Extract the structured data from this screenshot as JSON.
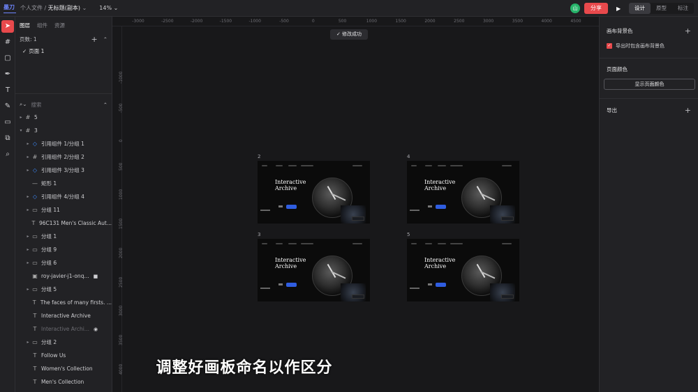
{
  "topbar": {
    "logo": "墨刀",
    "breadcrumb_parent": "个人文件",
    "separator": "/",
    "file_title": "无标题(副本)",
    "zoom": "14%",
    "avatar": "山",
    "share_label": "分享",
    "tabs": [
      "设计",
      "原型",
      "标注"
    ]
  },
  "left_panel": {
    "tabs": [
      "图层",
      "组件",
      "资源"
    ],
    "pages_label": "页数: 1",
    "pages": [
      {
        "label": "页面 1",
        "selected": true
      }
    ],
    "search_placeholder": "搜索",
    "layers": [
      {
        "label": "5",
        "icon": "frame-icon",
        "indent": 0,
        "arrow": "▸"
      },
      {
        "label": "3",
        "icon": "frame-icon",
        "indent": 0,
        "arrow": "▾"
      },
      {
        "label": "引用组件 1/分组 1",
        "icon": "component-icon",
        "indent": 1,
        "arrow": "▸"
      },
      {
        "label": "引用组件 2/分组 2",
        "icon": "frame-icon",
        "indent": 1,
        "arrow": "▸"
      },
      {
        "label": "引用组件 3/分组 3",
        "icon": "component-icon",
        "indent": 1,
        "arrow": "▸"
      },
      {
        "label": "矩形 1",
        "icon": "line-icon",
        "indent": 1,
        "arrow": ""
      },
      {
        "label": "引用组件 4/分组 4",
        "icon": "component-icon",
        "indent": 1,
        "arrow": "▸"
      },
      {
        "label": "分组 11",
        "icon": "folder-icon",
        "indent": 1,
        "arrow": "▸"
      },
      {
        "label": "96C131 Men's Classic Aut...",
        "icon": "text-icon",
        "indent": 1,
        "arrow": ""
      },
      {
        "label": "分组 1",
        "icon": "folder-icon",
        "indent": 1,
        "arrow": "▸"
      },
      {
        "label": "分组 9",
        "icon": "folder-icon",
        "indent": 1,
        "arrow": "▸"
      },
      {
        "label": "分组 6",
        "icon": "folder-icon",
        "indent": 1,
        "arrow": "▸"
      },
      {
        "label": "roy-javier-j1-onq...",
        "icon": "image-icon",
        "indent": 1,
        "arrow": "",
        "tail": "🔒"
      },
      {
        "label": "分组 5",
        "icon": "folder-icon",
        "indent": 1,
        "arrow": "▸"
      },
      {
        "label": "The faces of many firsts. ...",
        "icon": "text-icon",
        "indent": 1,
        "arrow": ""
      },
      {
        "label": "Interactive Archive",
        "icon": "text-icon",
        "indent": 1,
        "arrow": ""
      },
      {
        "label": "Interactive Archi...",
        "icon": "text-icon",
        "indent": 1,
        "arrow": "",
        "dim": true,
        "tail": "👁"
      },
      {
        "label": "分组 2",
        "icon": "folder-icon",
        "indent": 1,
        "arrow": "▸"
      },
      {
        "label": "Follow Us",
        "icon": "text-icon",
        "indent": 1,
        "arrow": ""
      },
      {
        "label": "Women's Collection",
        "icon": "text-icon",
        "indent": 1,
        "arrow": ""
      },
      {
        "label": "Men's Collection",
        "icon": "text-icon",
        "indent": 1,
        "arrow": ""
      }
    ]
  },
  "canvas": {
    "toast": "✓ 修改成功",
    "h_ruler": [
      "-3000",
      "-2500",
      "-2000",
      "-1500",
      "-1000",
      "-500",
      "0",
      "500",
      "1000",
      "1500",
      "2000",
      "2500",
      "3000",
      "3500",
      "4000",
      "4500"
    ],
    "v_ruler": [
      "-1000",
      "-500",
      "0",
      "500",
      "1000",
      "1500",
      "2000",
      "2500",
      "3000",
      "3500",
      "4000",
      "4500"
    ],
    "artboards": [
      {
        "label": "2",
        "hero": "Interactive Archive"
      },
      {
        "label": "4",
        "hero": "Interactive Archive"
      },
      {
        "label": "3",
        "hero": "Interactive Archive"
      },
      {
        "label": "5",
        "hero": "Interactive Archive"
      }
    ],
    "subtitle": "调整好画板命名以作区分"
  },
  "right_panel": {
    "bg_title": "画布背景色",
    "export_bg_label": "导出时包含画布背景色",
    "page_color_title": "页面颜色",
    "show_page_color_label": "显示页面颜色",
    "export_title": "导出"
  },
  "colors": {
    "accent": "#e8494c",
    "selection_blue": "#3e8bff",
    "button_blue": "#2f5de0"
  }
}
